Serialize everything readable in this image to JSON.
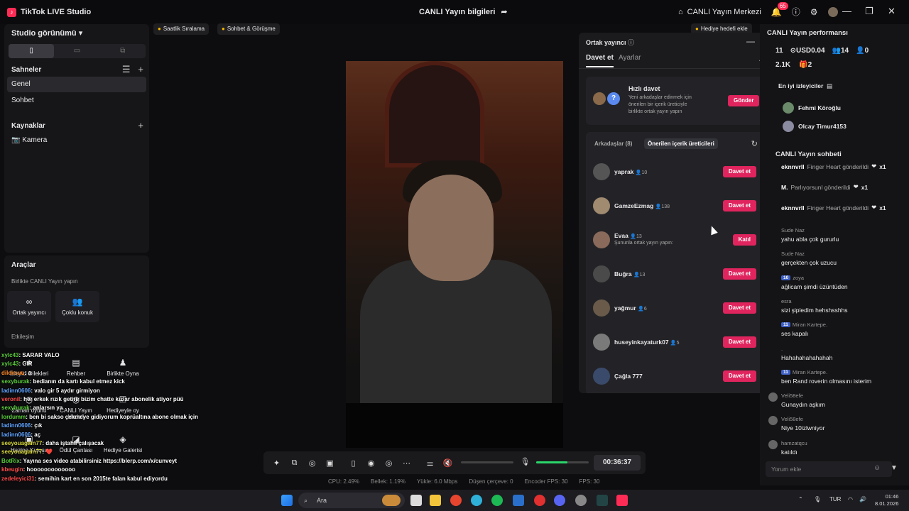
{
  "titlebar": {
    "app_name": "TikTok LIVE Studio",
    "center_title": "CANLI Yayın bilgileri",
    "live_center": "CANLI Yayın Merkezi",
    "notif_count": "65"
  },
  "left": {
    "studio_view": "Studio görünümü",
    "scenes_title": "Sahneler",
    "scenes": [
      "Genel",
      "Sohbet"
    ],
    "sources_title": "Kaynaklar",
    "sources": [
      "Kamera"
    ]
  },
  "tools": {
    "title": "Araçlar",
    "subtitle": "Birlikte CANLI Yayın yapın",
    "cohost": "Ortak yayıncı",
    "multi_guest": "Çoklu konuk",
    "interaction": "Etkileşim",
    "row2": [
      "İzleyici Dilekleri",
      "Rehber",
      "Birlikte Oyna"
    ],
    "row3": [
      "Zaman oyunu",
      "CANLI Yayın Hedefi",
      "Hediyeyle oy"
    ],
    "row4": [
      "Hazine Kutusu",
      "Ödül Çantası",
      "Hediye Galerisi"
    ]
  },
  "overlay_chat": [
    {
      "user": "xylc43",
      "msg": ": SARAR VALO",
      "c": "u1"
    },
    {
      "user": "xylc43",
      "msg": ": GIR",
      "c": "u1"
    },
    {
      "user": "dileksuu",
      "msg": ": a",
      "c": "u2"
    },
    {
      "user": "sexyburak",
      "msg": ": bedianın da kartı kabul etmez kick",
      "c": "u1"
    },
    {
      "user": "ladinn0606",
      "msg": ": valo gir 5 aydır girmiyon",
      "c": "u3"
    },
    {
      "user": "veronil",
      "msg": ": her erkek rızık getirir bizim chatte kızlar abonelik atiyor püü",
      "c": "u4"
    },
    {
      "user": "sexyburak",
      "msg": ": anlarsın ya",
      "c": "u1"
    },
    {
      "user": "lordumm",
      "msg": ": ben bi sakso çekmeye gidiyorum koprüaltına abone olmak için",
      "c": "u1"
    },
    {
      "user": "ladinn0606",
      "msg": ": çık",
      "c": "u3"
    },
    {
      "user": "ladinn0606",
      "msg": ": aç",
      "c": "u3"
    },
    {
      "user": "seeyouagain77",
      "msg": ": daha iştahlı çalışacak",
      "c": "u5"
    },
    {
      "user": "seeyouagain77",
      "msg": ": ❤️",
      "c": "u5"
    },
    {
      "user": "BotRix",
      "msg": ": Yayına ses video atabilirsiniz https://blerp.com/x/cunveyt",
      "c": "u1"
    },
    {
      "user": "kbeugin",
      "msg": ": hooooooooooooo",
      "c": "u4"
    },
    {
      "user": "zedeleyici31",
      "msg": ": semihin kart en son 2015te falan kabul ediyordu",
      "c": "u4"
    }
  ],
  "pills": {
    "hourly": "Saatlik Sıralama",
    "chat_meet": "Sohbet & Görüşme",
    "gift_goal": "Hediye hedefi ekle"
  },
  "controls": {
    "timer": "00:36:37"
  },
  "stats": {
    "cpu": "CPU: 2.49%",
    "mem": "Bellek: 1.19%",
    "upload": "Yükle: 6.0 Mbps",
    "dropped": "Düşen çerçeve: 0",
    "encoder": "Encoder FPS: 30",
    "fps": "FPS: 30"
  },
  "cohost": {
    "title": "Ortak yayıncı",
    "tab_invite": "Davet et",
    "tab_settings": "Ayarlar",
    "quick_title": "Hızlı davet",
    "quick_desc": "Yeni arkadaşlar edinmek için önerilen bir içerik üreticiyle birlikte ortak yayın yapın",
    "send": "Gönder",
    "tab_friends": "Arkadaşlar (8)",
    "tab_suggested": "Önerilen içerik üreticileri",
    "creators": [
      {
        "name": "yaprak",
        "count": "10",
        "btn": "Davet et",
        "sub": ""
      },
      {
        "name": "GamzeEzmag",
        "count": "138",
        "btn": "Davet et",
        "sub": ""
      },
      {
        "name": "Evaa",
        "count": "13",
        "btn": "Katıl",
        "sub": "Şununla ortak yayın yapın:"
      },
      {
        "name": "Buğra",
        "count": "13",
        "btn": "Davet et",
        "sub": ""
      },
      {
        "name": "yağmur",
        "count": "6",
        "btn": "Davet et",
        "sub": ""
      },
      {
        "name": "huseyinkayaturk07",
        "count": "5",
        "btn": "Davet et",
        "sub": ""
      },
      {
        "name": "Çağla 777",
        "count": "",
        "btn": "Davet et",
        "sub": ""
      }
    ]
  },
  "right": {
    "perf_title": "CANLI Yayın performansı",
    "stat1": "11",
    "stat2": "USD0.04",
    "stat3": "14",
    "stat4": "0",
    "stat5": "2.1K",
    "stat6": "2",
    "top_viewers": "En iyi izleyiciler",
    "viewers": [
      "Fehmi Köroğlu",
      "Olcay Timur4153"
    ],
    "chat_title": "CANLI Yayın sohbeti",
    "gifts": [
      {
        "user": "eknnvrll",
        "text": "Finger Heart gönderildi",
        "x": "x1"
      },
      {
        "user": "M.",
        "text": "Parlıyorsunl gönderildi",
        "x": "x1"
      },
      {
        "user": "eknnvrll",
        "text": "Finger Heart gönderildi",
        "x": "x1"
      }
    ],
    "comments": [
      {
        "name": "Sude Naz",
        "lvl": "",
        "text": "yahu abla çok gururlu"
      },
      {
        "name": "Sude Naz",
        "lvl": "",
        "text": "gerçekten çok uzucu"
      },
      {
        "name": "zoya",
        "lvl": "10",
        "text": "ağlicam şimdi üzüntüden"
      },
      {
        "name": "esra",
        "lvl": "",
        "text": "sizi şipledim hehshsshhs"
      },
      {
        "name": "Miran Kartepe.",
        "lvl": "11",
        "text": "ses kapalı"
      },
      {
        "name": ".",
        "lvl": "",
        "text": "Hahahahahahahah"
      },
      {
        "name": "Miran Kartepe.",
        "lvl": "11",
        "text": "ben Rand roverin olmasını isterim"
      },
      {
        "name": "Veli58efe",
        "lvl": "",
        "text": "Gunaydın aşkım"
      },
      {
        "name": "Veli58efe",
        "lvl": "",
        "text": "Niye 10izlwniyor"
      },
      {
        "name": "hamzatqcu",
        "lvl": "",
        "text": "katıldı"
      }
    ],
    "comment_placeholder": "Yorum ekle"
  },
  "taskbar": {
    "search": "Ara",
    "lang": "TUR",
    "time": "01:46",
    "date": "8.01.2026"
  }
}
